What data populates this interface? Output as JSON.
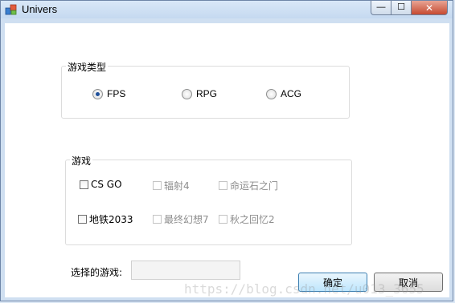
{
  "window": {
    "title": "Univers",
    "min_glyph": "—",
    "max_glyph": "☐",
    "close_glyph": "✕"
  },
  "game_type": {
    "label": "游戏类型",
    "options": [
      {
        "label": "FPS",
        "checked": true
      },
      {
        "label": "RPG",
        "checked": false
      },
      {
        "label": "ACG",
        "checked": false
      }
    ]
  },
  "games": {
    "label": "游戏",
    "items": [
      {
        "label": "CS GO",
        "enabled": true
      },
      {
        "label": "辐射4",
        "enabled": false
      },
      {
        "label": "命运石之门",
        "enabled": false
      },
      {
        "label": "地铁2033",
        "enabled": true
      },
      {
        "label": "最终幻想7",
        "enabled": false
      },
      {
        "label": "秋之回忆2",
        "enabled": false
      }
    ]
  },
  "selection": {
    "label": "选择的游戏:",
    "value": ""
  },
  "buttons": {
    "ok": "确定",
    "cancel": "取消"
  },
  "watermark": "https://blog.csdn.net/u013_3655"
}
